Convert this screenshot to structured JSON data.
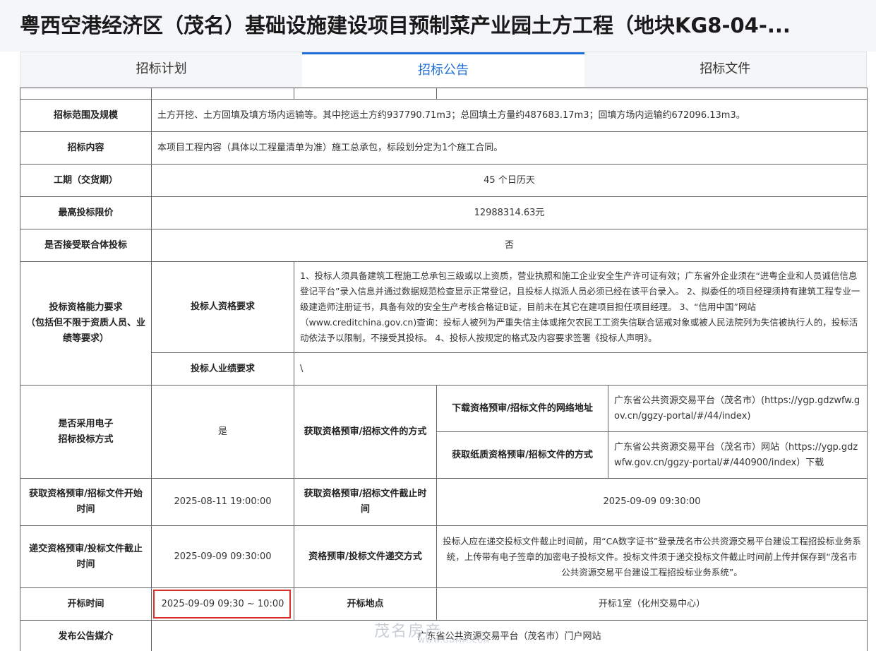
{
  "page": {
    "title": "粤西空港经济区（茂名）基础设施建设项目预制菜产业园土方工程（地块KG8-04-..."
  },
  "tabs": [
    {
      "label": "招标计划"
    },
    {
      "label": "招标公告"
    },
    {
      "label": "招标文件"
    }
  ],
  "table": {
    "scope": {
      "label": "招标范围及规模",
      "value": "土方开挖、土方回填及填方场内运输等。其中挖运土方约937790.71m3；总回填土方量约487683.17m3；回填方场内运输约672096.13m3。"
    },
    "content": {
      "label": "招标内容",
      "value": "本项目工程内容（具体以工程量清单为准）施工总承包，标段划分定为1个施工合同。"
    },
    "period": {
      "label": "工期（交货期）",
      "value": "45 个日历天"
    },
    "max_price": {
      "label": "最高投标限价",
      "value": "12988314.63元"
    },
    "joint": {
      "label": "是否接受联合体投标",
      "value": "否"
    },
    "qualification": {
      "label": "投标资格能力要求\n（包括但不限于资质人员、业绩等要求）",
      "bidder_label": "投标人资格要求",
      "bidder_value": "1、投标人须具备建筑工程施工总承包三级或以上资质，营业执照和施工企业安全生产许可证有效；广东省外企业须在“进粤企业和人员诚信信息登记平台”录入信息并通过数据规范检查显示正常登记，且投标人拟派人员必须已经在该平台录入。 2、拟委任的项目经理须持有建筑工程专业一级建造师注册证书，具备有效的安全生产考核合格证B证，目前未在其它在建项目担任项目经理。 3、“信用中国”网站（www.creditchina.gov.cn)查询：投标人被列为严重失信主体或拖欠农民工工资失信联合惩戒对象或被人民法院列为失信被执行人的，投标活动依法予以限制，不接受其投标。 4、投标人按规定的格式及内容要求签署《投标人声明》。",
      "performance_label": "投标人业绩要求",
      "performance_value": "\\"
    },
    "electronic": {
      "label": "是否采用电子\n招标投标方式",
      "value": "是",
      "method_label": "获取资格预审/招标文件的方式",
      "download_label": "下载资格预审/招标文件的网络地址",
      "download_value": "广东省公共资源交易平台（茂名市）(https://ygp.gdzwfw.gov.cn/ggzy-portal/#/44/index)",
      "paper_label": "获取纸质资格预审/招标文件的方式",
      "paper_value": "广东省公共资源交易平台（茂名市）网站（https://ygp.gdzwfw.gov.cn/ggzy-portal/#/440900/index）下载"
    },
    "obtain_time": {
      "start_label": "获取资格预审/招标文件开始时间",
      "start_value": "2025-08-11 19:00:00",
      "end_label": "获取资格预审/招标文件截止时间",
      "end_value": "2025-09-09 09:30:00"
    },
    "submit": {
      "deadline_label": "递交资格预审/投标文件截止时间",
      "deadline_value": "2025-09-09 09:30:00",
      "method_label": "资格预审/投标文件递交方式",
      "method_value": "投标人应在递交投标文件截止时间前，用“CA数字证书”登录茂名市公共资源交易平台建设工程招投标业务系统，上传带有电子签章的加密电子投标文件。投标文件须于递交投标文件截止时间前上传并保存到“茂名市公共资源交易平台建设工程招投标业务系统”。"
    },
    "opening": {
      "time_label": "开标时间",
      "time_value": "2025-09-09 09:30 ~ 10:00",
      "place_label": "开标地点",
      "place_value": "开标1室（化州交易中心）"
    },
    "media": {
      "label": "发布公告媒介",
      "value": "广东省公共资源交易平台（茂名市）门户网站"
    }
  },
  "watermark": {
    "text": "茂名房产",
    "sub": "WWW.GDMM.COM"
  }
}
